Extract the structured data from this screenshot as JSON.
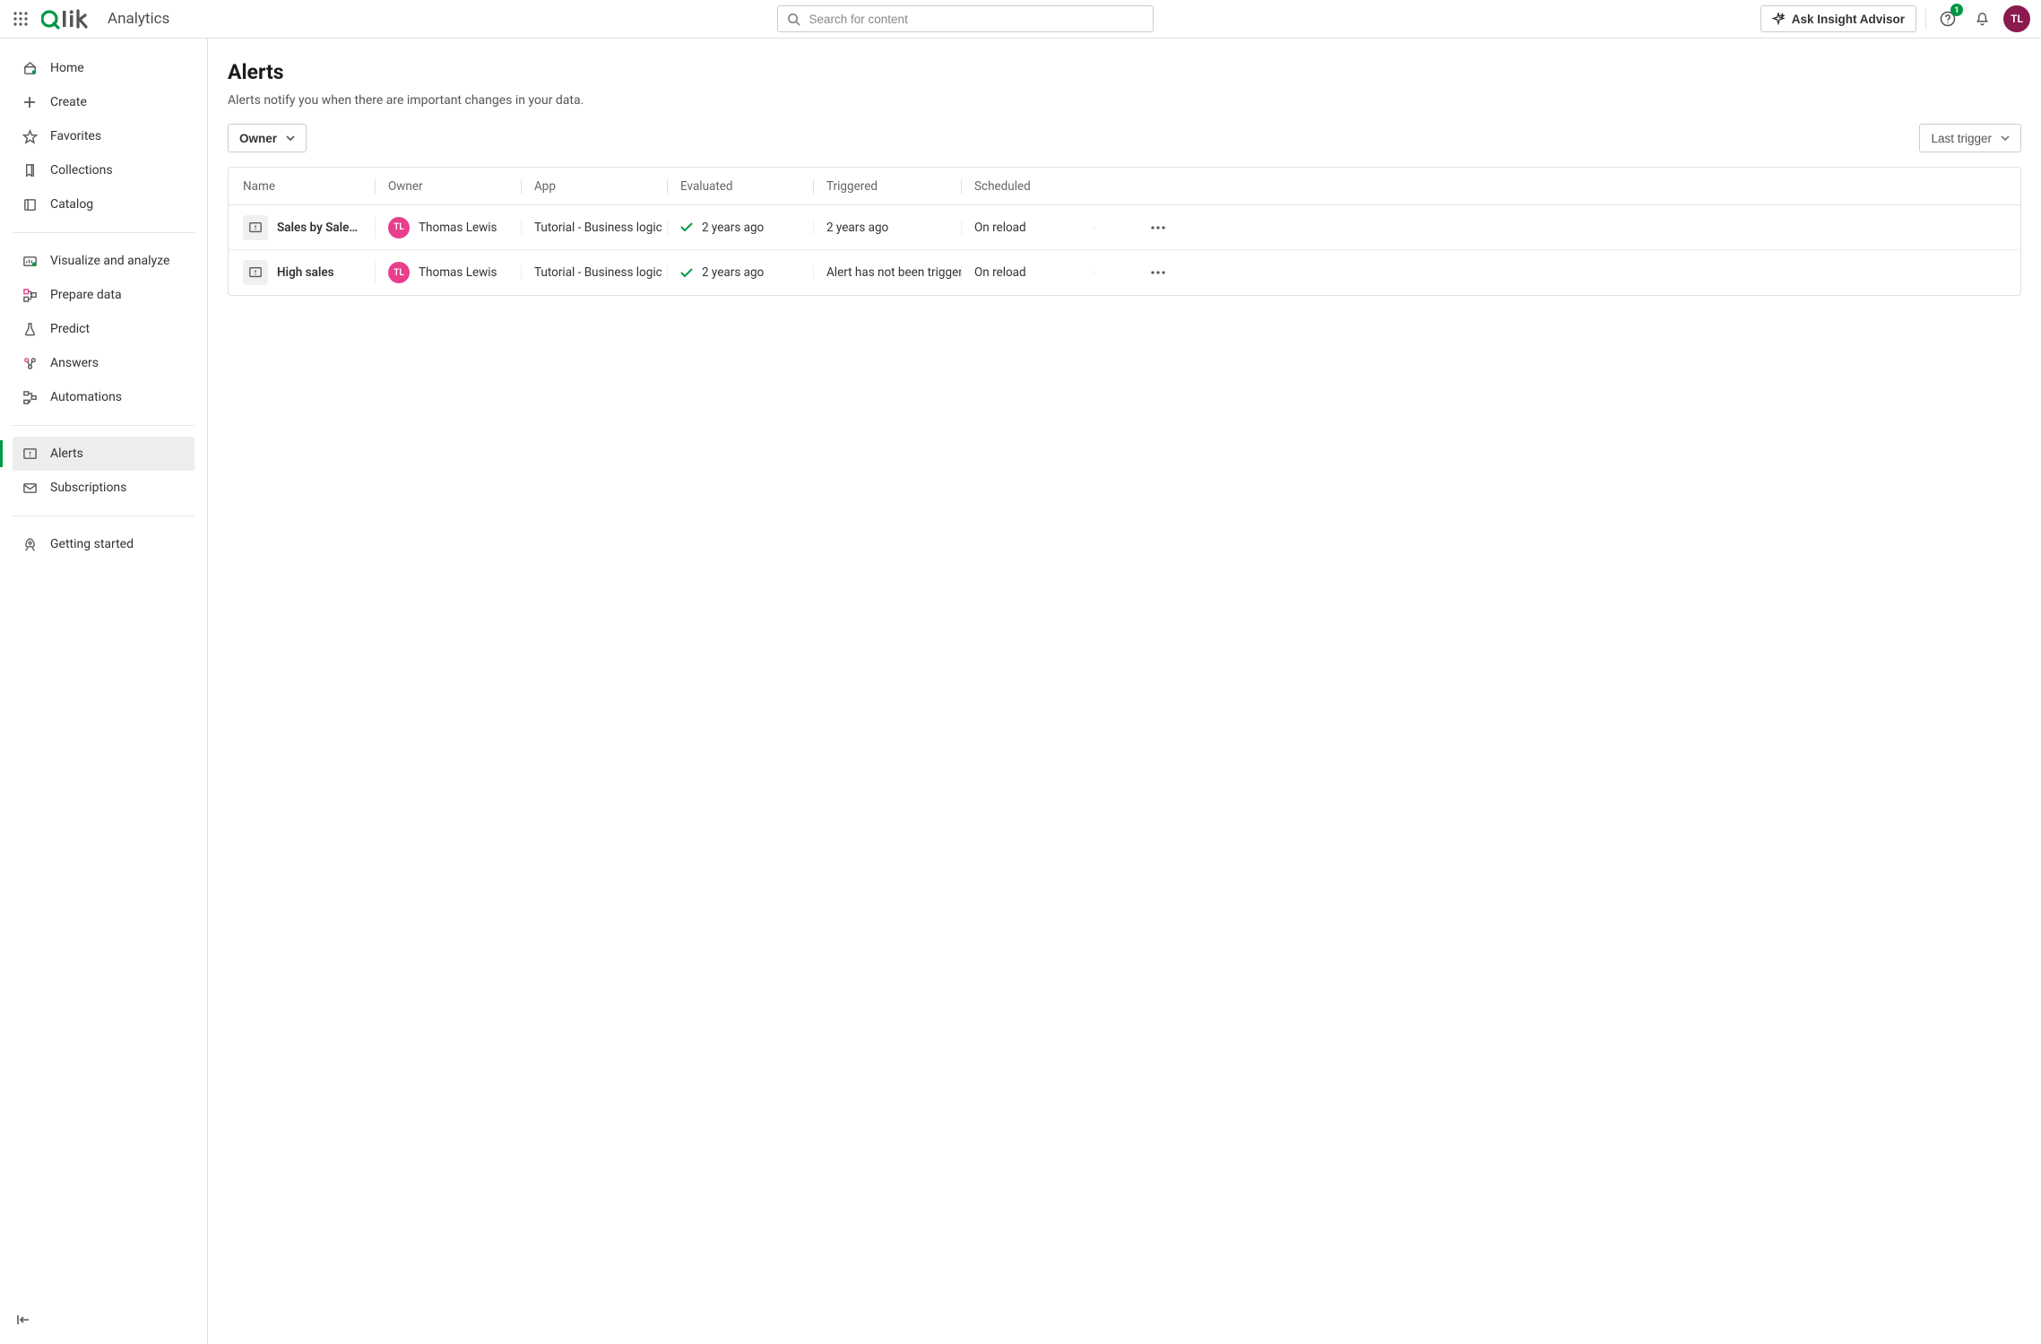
{
  "header": {
    "brand_product": "Analytics",
    "search_placeholder": "Search for content",
    "insight_button": "Ask Insight Advisor",
    "help_badge": "1",
    "avatar_initials": "TL"
  },
  "sidebar": {
    "items_g1": [
      {
        "label": "Home"
      },
      {
        "label": "Create"
      },
      {
        "label": "Favorites"
      },
      {
        "label": "Collections"
      },
      {
        "label": "Catalog"
      }
    ],
    "items_g2": [
      {
        "label": "Visualize and analyze"
      },
      {
        "label": "Prepare data"
      },
      {
        "label": "Predict"
      },
      {
        "label": "Answers"
      },
      {
        "label": "Automations"
      }
    ],
    "items_g3": [
      {
        "label": "Alerts"
      },
      {
        "label": "Subscriptions"
      }
    ],
    "items_g4": [
      {
        "label": "Getting started"
      }
    ]
  },
  "page": {
    "title": "Alerts",
    "subtitle": "Alerts notify you when there are important changes in your data.",
    "filter_owner_label": "Owner",
    "sort_label": "Last trigger"
  },
  "table": {
    "columns": {
      "name": "Name",
      "owner": "Owner",
      "app": "App",
      "evaluated": "Evaluated",
      "triggered": "Triggered",
      "scheduled": "Scheduled"
    },
    "rows": [
      {
        "name": "Sales by SalesOff…",
        "owner_initials": "TL",
        "owner": "Thomas Lewis",
        "app": "Tutorial - Business logic",
        "evaluated": "2 years ago",
        "triggered": "2 years ago",
        "scheduled": "On reload"
      },
      {
        "name": "High sales",
        "owner_initials": "TL",
        "owner": "Thomas Lewis",
        "app": "Tutorial - Business logic",
        "evaluated": "2 years ago",
        "triggered": "Alert has not been triggered",
        "scheduled": "On reload"
      }
    ]
  }
}
